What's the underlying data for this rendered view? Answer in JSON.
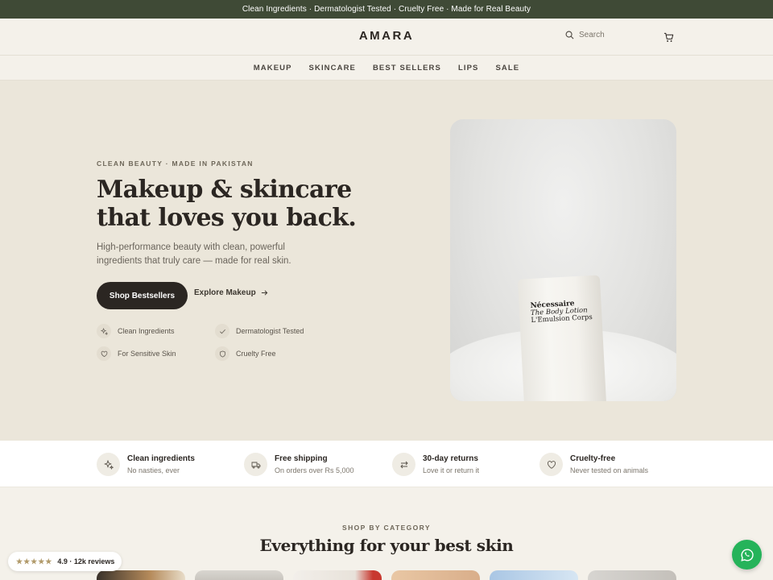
{
  "announcement": "Clean Ingredients · Dermatologist Tested · Cruelty Free · Made for Real Beauty",
  "header": {
    "logo": "AMARA",
    "search_placeholder": "Search",
    "cart_icon": "cart-icon"
  },
  "nav": [
    "MAKEUP",
    "SKINCARE",
    "BEST SELLERS",
    "LIPS",
    "SALE"
  ],
  "hero": {
    "eyebrow": "CLEAN BEAUTY · MADE IN PAKISTAN",
    "headline": "Makeup & skincare that loves you back.",
    "subtext": "High-performance beauty with clean, powerful ingredients that truly care — made for real skin.",
    "primary_cta": "Shop Bestsellers",
    "secondary_cta": "Explore Makeup",
    "badges": [
      "Clean Ingredients",
      "Dermatologist Tested",
      "For Sensitive Skin",
      "Cruelty Free"
    ],
    "product": {
      "brand": "Nécessaire",
      "line1": "The Body Lotion",
      "line2": "L'Emulsion Corps"
    }
  },
  "features": [
    {
      "title": "Clean ingredients",
      "subtitle": "No nasties, ever",
      "icon": "sparkle-icon"
    },
    {
      "title": "Free shipping",
      "subtitle": "On orders over Rs 5,000",
      "icon": "truck-icon"
    },
    {
      "title": "30-day returns",
      "subtitle": "Love it or return it",
      "icon": "exchange-icon"
    },
    {
      "title": "Cruelty-free",
      "subtitle": "Never tested on animals",
      "icon": "heart-icon"
    }
  ],
  "categories": {
    "eyebrow": "SHOP BY CATEGORY",
    "title": "Everything for your best skin"
  },
  "rating": {
    "stars": "★★★★★",
    "text": "4.9 · 12k reviews"
  },
  "colors": {
    "announcement_bg": "#3f4a36",
    "primary_button": "#2b2622",
    "hero_bg": "#ebe6da",
    "whatsapp": "#25b35a",
    "star": "#b19a6a"
  }
}
